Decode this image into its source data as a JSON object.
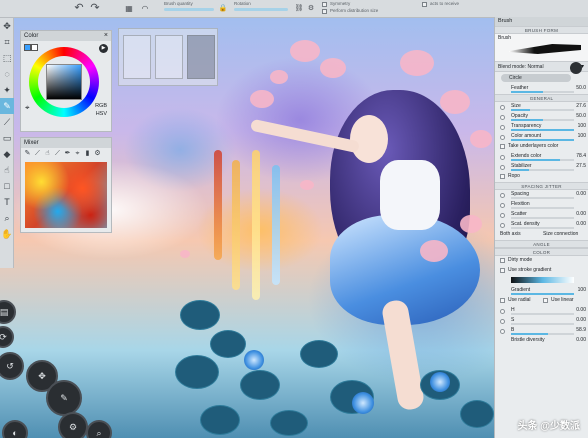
{
  "top_bar": {
    "undo_icon": "undo-icon",
    "redo_icon": "redo-icon",
    "fields": [
      {
        "label": "Brush quantity"
      },
      {
        "label": "Rotation"
      },
      {
        "label": "Symmetry"
      },
      {
        "label": "Perform distribution size"
      },
      {
        "label": "acts to receive"
      }
    ]
  },
  "left_toolbar": {
    "tools": [
      "move-icon",
      "crop-icon",
      "marquee-icon",
      "lasso-icon",
      "wand-icon",
      "brush-icon",
      "eyedropper-icon",
      "eraser-icon",
      "fill-icon",
      "smudge-icon",
      "shape-icon",
      "text-icon",
      "zoom-icon",
      "hand-icon"
    ],
    "active_index": 5
  },
  "color_panel": {
    "title": "Color",
    "modes": [
      "RGB",
      "HSV"
    ],
    "current_color": "#3aa0ff"
  },
  "mixer_panel": {
    "title": "Mixer"
  },
  "brush_panel": {
    "title": "Brush",
    "preview_title": "BRUSH FORM",
    "brush_label": "Brush",
    "blend_mode": "Blend mode: Normal",
    "shape": "Circle",
    "feather_label": "Feather",
    "feather_value": "50.0",
    "sections": {
      "general": "GENERAL",
      "spacing_jitter": "SPACING JITTER",
      "angle": "ANGLE",
      "color": "COLOR"
    },
    "general_rows": [
      {
        "label": "Size",
        "value": "27.6",
        "fill": 0.3
      },
      {
        "label": "Opacity",
        "value": "50.0",
        "fill": 0.5
      },
      {
        "label": "Transparency",
        "value": "100",
        "fill": 1.0
      },
      {
        "label": "Color amount",
        "value": "100",
        "fill": 1.0
      }
    ],
    "take_underlayers": "Take underlayers color",
    "general_rows_2": [
      {
        "label": "Extends color",
        "value": "78.4",
        "fill": 0.78
      },
      {
        "label": "Stabilizer",
        "value": "27.5",
        "fill": 0.28
      }
    ],
    "ropo": "Ropo",
    "spacing_rows": [
      {
        "label": "Spacing",
        "value": "0.00",
        "fill": 0.0
      },
      {
        "label": "Flexition",
        "value": "",
        "fill": 0.0
      },
      {
        "label": "Scatter",
        "value": "0.00",
        "fill": 0.0
      },
      {
        "label": "Scat. density",
        "value": "0.00",
        "fill": 0.0
      }
    ],
    "both_axis": "Both axis",
    "size_connection": "Size connection",
    "color_checks": [
      "Dirty mode",
      "Use stroke gradient"
    ],
    "gradient_label": "Gradient",
    "gradient_value": "100",
    "use_radial": "Use radial",
    "use_linear": "Use linear",
    "hsb_rows": [
      {
        "label": "H",
        "value": "0.00",
        "fill": 0.0
      },
      {
        "label": "S",
        "value": "0.00",
        "fill": 0.0
      },
      {
        "label": "B",
        "value": "58.9",
        "fill": 0.59
      }
    ],
    "bristle_label": "Bristle diversity",
    "bristle_value": "0.00"
  },
  "bottom_controls": [
    "layers-icon",
    "rotate-icon",
    "undo-round-icon",
    "pan-icon",
    "pen-icon",
    "settings-icon"
  ],
  "watermark": "头条 @少数派"
}
